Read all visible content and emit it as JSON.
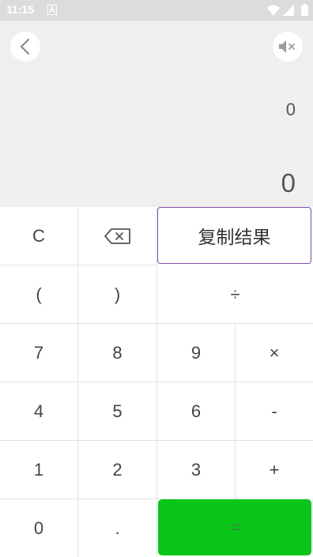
{
  "status_bar": {
    "time": "11:15",
    "icons": [
      "notification-a-icon",
      "wifi-icon",
      "signal-icon",
      "battery-icon"
    ]
  },
  "display": {
    "back_icon": "chevron-left-icon",
    "sound_icon": "speaker-muted-icon",
    "expression": "0",
    "result": "0"
  },
  "keypad": {
    "clear": "C",
    "backspace_icon": "backspace-icon",
    "copy": "复制结果",
    "paren_open": "(",
    "paren_close": ")",
    "divide": "÷",
    "seven": "7",
    "eight": "8",
    "nine": "9",
    "multiply": "×",
    "four": "4",
    "five": "5",
    "six": "6",
    "minus": "-",
    "one": "1",
    "two": "2",
    "three": "3",
    "plus": "+",
    "zero": "0",
    "dot": ".",
    "equals": "="
  },
  "colors": {
    "accent_green": "#0ac51a",
    "copy_border": "#7b4ea8",
    "display_bg": "#efefef"
  }
}
